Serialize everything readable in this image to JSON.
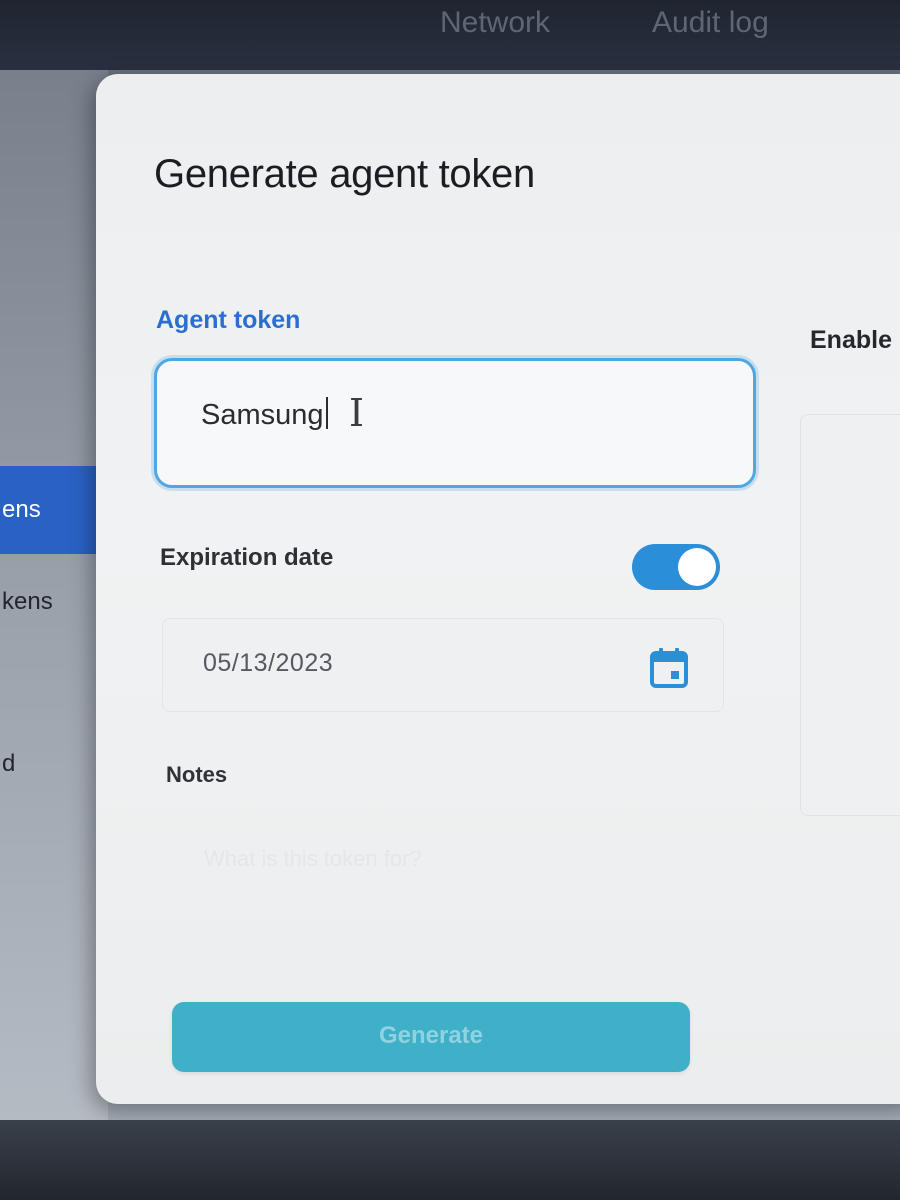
{
  "topnav": {
    "network": "Network",
    "audit_log": "Audit log"
  },
  "sidebar": {
    "items": [
      {
        "label": "ens",
        "active": true
      },
      {
        "label": "kens",
        "active": false
      },
      {
        "label": "d",
        "active": false
      }
    ]
  },
  "modal": {
    "title": "Generate agent token",
    "agent_token": {
      "label": "Agent token",
      "value": "Samsung"
    },
    "expiration": {
      "label": "Expiration date",
      "enabled": true,
      "date": "05/13/2023"
    },
    "notes": {
      "label": "Notes",
      "placeholder": "What is this token for?"
    },
    "generate_label": "Generate",
    "enable_label": "Enable"
  },
  "icons": {
    "calendar": "calendar-icon",
    "toggle": "toggle-on"
  },
  "colors": {
    "accent": "#2a6fd0",
    "toggle_on": "#2a8fd8",
    "button": "#3fb0c8",
    "sidebar_active": "#2a62c4"
  }
}
